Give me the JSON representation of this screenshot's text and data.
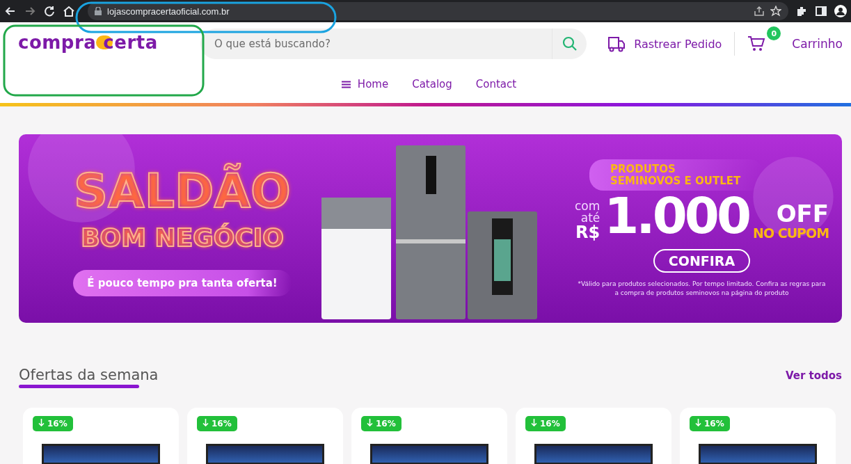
{
  "browser": {
    "url": "lojascompracertaoficial.com.br"
  },
  "header": {
    "logo": {
      "left": "compra",
      "right": "certa"
    },
    "search": {
      "placeholder": "O que está buscando?"
    },
    "track_order": "Rastrear Pedido",
    "cart": {
      "count": "0",
      "label": "Carrinho"
    }
  },
  "nav": [
    {
      "label": "Home",
      "menu_icon": true
    },
    {
      "label": "Catalog",
      "menu_icon": false
    },
    {
      "label": "Contact",
      "menu_icon": false
    }
  ],
  "banner": {
    "title": "SALDÃO",
    "subtitle": "BOM NEGÓCIO",
    "tagline": "É pouco tempo pra tanta oferta!",
    "pill": "PRODUTOS SEMINOVOS E OUTLET",
    "prefix_1": "com",
    "prefix_2": "até",
    "currency": "R$",
    "amount": "1.000",
    "off": "OFF",
    "coupon": "NO CUPOM",
    "cta": "CONFIRA",
    "disclaimer": "*Válido para produtos selecionados. Por tempo limitado. Confira as regras para a compra de produtos seminovos na página do produto"
  },
  "section": {
    "title": "Ofertas da semana",
    "link": "Ver todos"
  },
  "products": [
    {
      "discount": "16%"
    },
    {
      "discount": "16%"
    },
    {
      "discount": "16%"
    },
    {
      "discount": "16%"
    },
    {
      "discount": "16%"
    }
  ]
}
